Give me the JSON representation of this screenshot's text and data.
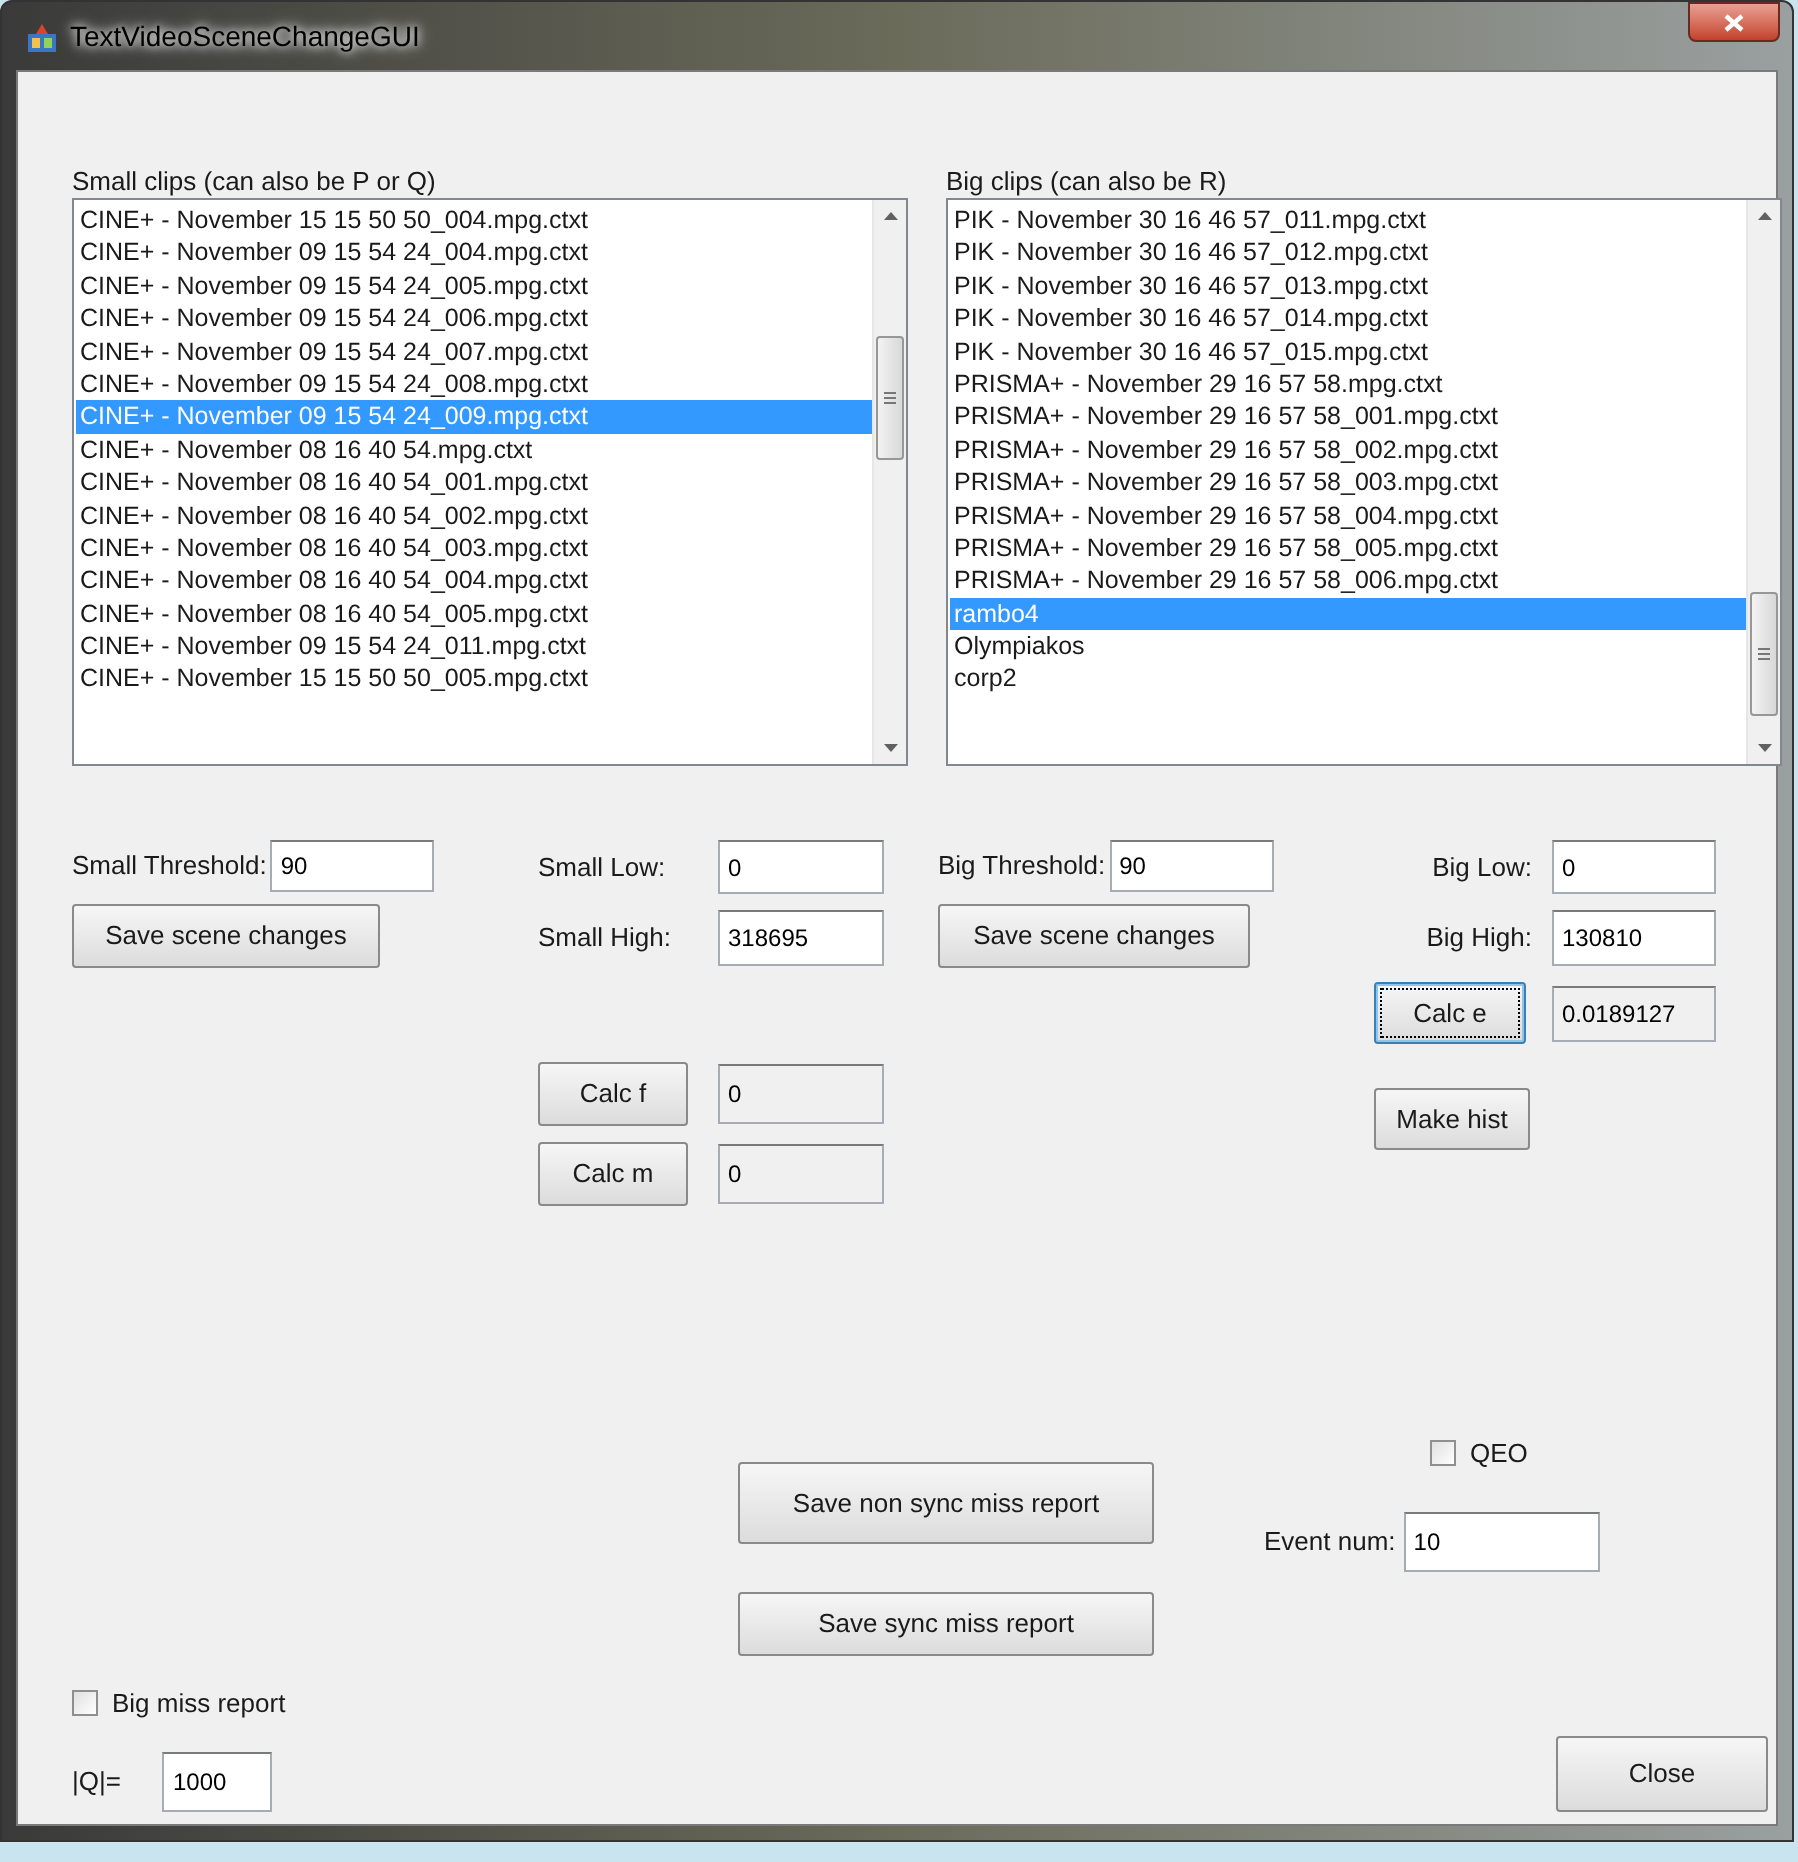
{
  "window": {
    "title": "TextVideoSceneChangeGUI"
  },
  "small_clips": {
    "label": "Small clips (can also be P or Q)",
    "items": [
      {
        "text": "CINE+ - November 15 15 50 50_004.mpg.ctxt",
        "selected": false
      },
      {
        "text": "CINE+ - November 09 15 54 24_004.mpg.ctxt",
        "selected": false
      },
      {
        "text": "CINE+ - November 09 15 54 24_005.mpg.ctxt",
        "selected": false
      },
      {
        "text": "CINE+ - November 09 15 54 24_006.mpg.ctxt",
        "selected": false
      },
      {
        "text": "CINE+ - November 09 15 54 24_007.mpg.ctxt",
        "selected": false
      },
      {
        "text": "CINE+ - November 09 15 54 24_008.mpg.ctxt",
        "selected": false
      },
      {
        "text": "CINE+ - November 09 15 54 24_009.mpg.ctxt",
        "selected": true
      },
      {
        "text": "CINE+ - November 08 16 40 54.mpg.ctxt",
        "selected": false
      },
      {
        "text": "CINE+ - November 08 16 40 54_001.mpg.ctxt",
        "selected": false
      },
      {
        "text": "CINE+ - November 08 16 40 54_002.mpg.ctxt",
        "selected": false
      },
      {
        "text": "CINE+ - November 08 16 40 54_003.mpg.ctxt",
        "selected": false
      },
      {
        "text": "CINE+ - November 08 16 40 54_004.mpg.ctxt",
        "selected": false
      },
      {
        "text": "CINE+ - November 08 16 40 54_005.mpg.ctxt",
        "selected": false
      },
      {
        "text": "CINE+ - November 09 15 54 24_011.mpg.ctxt",
        "selected": false
      },
      {
        "text": "CINE+ - November 15 15 50 50_005.mpg.ctxt",
        "selected": false
      }
    ]
  },
  "big_clips": {
    "label": "Big clips (can also be R)",
    "items": [
      {
        "text": "PIK - November 30 16 46 57_011.mpg.ctxt",
        "selected": false
      },
      {
        "text": "PIK - November 30 16 46 57_012.mpg.ctxt",
        "selected": false
      },
      {
        "text": "PIK - November 30 16 46 57_013.mpg.ctxt",
        "selected": false
      },
      {
        "text": "PIK - November 30 16 46 57_014.mpg.ctxt",
        "selected": false
      },
      {
        "text": "PIK - November 30 16 46 57_015.mpg.ctxt",
        "selected": false
      },
      {
        "text": "PRISMA+ - November 29 16 57 58.mpg.ctxt",
        "selected": false
      },
      {
        "text": "PRISMA+ - November 29 16 57 58_001.mpg.ctxt",
        "selected": false
      },
      {
        "text": "PRISMA+ - November 29 16 57 58_002.mpg.ctxt",
        "selected": false
      },
      {
        "text": "PRISMA+ - November 29 16 57 58_003.mpg.ctxt",
        "selected": false
      },
      {
        "text": "PRISMA+ - November 29 16 57 58_004.mpg.ctxt",
        "selected": false
      },
      {
        "text": "PRISMA+ - November 29 16 57 58_005.mpg.ctxt",
        "selected": false
      },
      {
        "text": "PRISMA+ - November 29 16 57 58_006.mpg.ctxt",
        "selected": false
      },
      {
        "text": "rambo4",
        "selected": true
      },
      {
        "text": "Olympiakos",
        "selected": false
      },
      {
        "text": "corp2",
        "selected": false
      }
    ]
  },
  "small_threshold": {
    "label": "Small Threshold:",
    "value": "90",
    "readonly": false
  },
  "small_save": {
    "label": "Save scene changes",
    "focused": false
  },
  "small_low": {
    "label": "Small Low:",
    "value": "0",
    "readonly": false
  },
  "small_high": {
    "label": "Small High:",
    "value": "318695",
    "readonly": false
  },
  "calc_f": {
    "button": {
      "label": "Calc f",
      "focused": false
    },
    "value": "0",
    "readonly": true
  },
  "calc_m": {
    "button": {
      "label": "Calc m",
      "focused": false
    },
    "value": "0",
    "readonly": true
  },
  "big_threshold": {
    "label": "Big Threshold:",
    "value": "90",
    "readonly": false
  },
  "big_save": {
    "label": "Save scene changes",
    "focused": false
  },
  "big_low": {
    "label": "Big Low:",
    "value": "0",
    "readonly": false
  },
  "big_high": {
    "label": "Big High:",
    "value": "130810",
    "readonly": false
  },
  "calc_e": {
    "button": {
      "label": "Calc e",
      "focused": true
    },
    "value": "0.0189127",
    "readonly": true
  },
  "make_hist": {
    "label": "Make hist",
    "focused": false
  },
  "save_non_sync": {
    "label": "Save non sync miss report",
    "focused": false
  },
  "save_sync": {
    "label": "Save sync miss report",
    "focused": false
  },
  "qeo": {
    "label": "QEO",
    "checked": false
  },
  "event_num": {
    "label": "Event num:",
    "value": "10",
    "readonly": false
  },
  "big_miss_report": {
    "label": "Big miss report",
    "checked": false
  },
  "q_size": {
    "label": "|Q|=",
    "value": "1000",
    "readonly": false
  },
  "close": {
    "label": "Close",
    "focused": false
  }
}
